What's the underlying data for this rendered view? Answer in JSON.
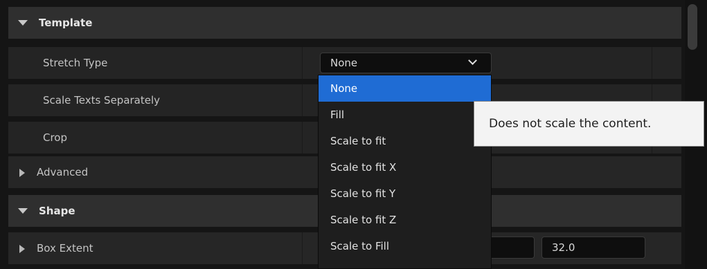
{
  "sections": {
    "template": {
      "label": "Template"
    },
    "shape": {
      "label": "Shape"
    }
  },
  "properties": {
    "stretch_type": {
      "label": "Stretch Type",
      "value": "None"
    },
    "scale_texts": {
      "label": "Scale Texts Separately"
    },
    "crop": {
      "label": "Crop"
    },
    "advanced": {
      "label": "Advanced"
    },
    "box_extent": {
      "label": "Box Extent",
      "z": "32.0"
    }
  },
  "dropdown": {
    "options": [
      "None",
      "Fill",
      "Scale to fit",
      "Scale to fit X",
      "Scale to fit Y",
      "Scale to fit Z",
      "Scale to Fill"
    ],
    "selected": "None"
  },
  "tooltip": {
    "text": "Does not scale the content."
  },
  "colors": {
    "selection": "#1f6cd4",
    "panel": "#242424",
    "header": "#2f2f2f"
  }
}
